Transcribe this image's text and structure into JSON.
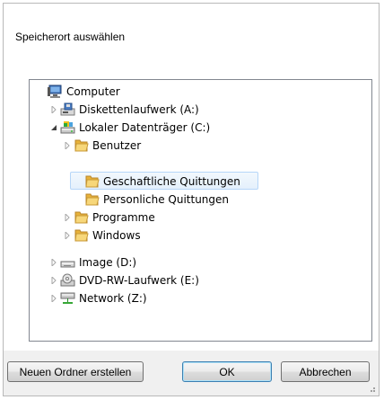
{
  "dialog": {
    "prompt": "Speicherort auswählen"
  },
  "tree": {
    "items": [
      {
        "label": "Computer",
        "icon": "computer-icon"
      },
      {
        "label": "Diskettenlaufwerk (A:)",
        "icon": "floppy-drive-icon"
      },
      {
        "label": "Lokaler Datenträger (C:)",
        "icon": "local-disk-icon"
      },
      {
        "label": "Benutzer",
        "icon": "folder-icon"
      },
      {
        "label": "Geschaftliche Quittungen",
        "icon": "folder-icon",
        "selected": true
      },
      {
        "label": "Personliche Quittungen",
        "icon": "folder-icon"
      },
      {
        "label": "Programme",
        "icon": "folder-icon"
      },
      {
        "label": "Windows",
        "icon": "folder-icon"
      },
      {
        "label": "Image (D:)",
        "icon": "removable-drive-icon"
      },
      {
        "label": "DVD-RW-Laufwerk (E:)",
        "icon": "dvd-drive-icon"
      },
      {
        "label": "Network (Z:)",
        "icon": "network-drive-icon"
      }
    ]
  },
  "buttons": {
    "new_folder": "Neuen Ordner erstellen",
    "ok": "OK",
    "cancel": "Abbrechen"
  },
  "colors": {
    "selection_fill": "#e4f0fc",
    "selection_border": "#b6d6f8",
    "folder": "#f2c75a"
  }
}
